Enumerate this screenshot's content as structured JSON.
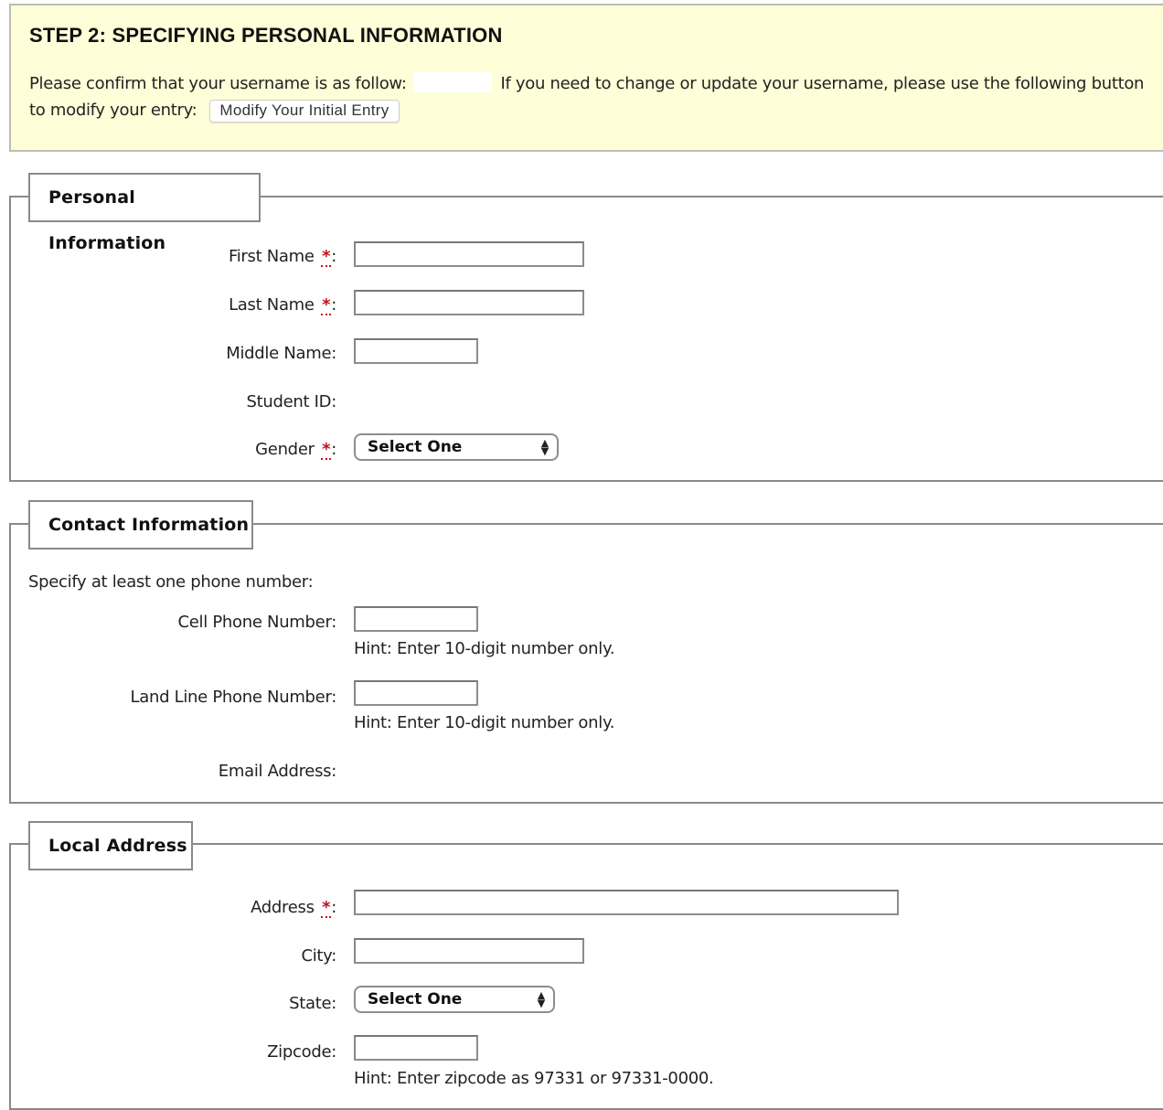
{
  "step": {
    "title": "STEP 2: SPECIFYING PERSONAL INFORMATION",
    "confirm_prefix": "Please confirm that your username is as follow:",
    "username_value": "",
    "confirm_suffix": "If you need to change or update your username, please use the following button",
    "modify_prefix": "to modify your entry:",
    "modify_button": "Modify Your Initial Entry"
  },
  "personal": {
    "legend": "Personal Information",
    "first_name": {
      "label": "First Name",
      "required": "*",
      "colon": ":",
      "value": ""
    },
    "last_name": {
      "label": "Last Name",
      "required": "*",
      "colon": ":",
      "value": ""
    },
    "middle_name": {
      "label": "Middle Name:",
      "value": ""
    },
    "student_id": {
      "label": "Student ID:",
      "value": ""
    },
    "gender": {
      "label": "Gender",
      "required": "*",
      "colon": ":",
      "selected": "Select One"
    }
  },
  "contact": {
    "legend": "Contact Information",
    "intro": "Specify at least one phone number:",
    "cell": {
      "label": "Cell Phone Number:",
      "value": "",
      "hint": "Hint: Enter 10-digit number only."
    },
    "landline": {
      "label": "Land Line Phone Number:",
      "value": "",
      "hint": "Hint: Enter 10-digit number only."
    },
    "email": {
      "label": "Email Address:",
      "value": ""
    }
  },
  "address": {
    "legend": "Local Address",
    "address": {
      "label": "Address",
      "required": "*",
      "colon": ":",
      "value": ""
    },
    "city": {
      "label": "City:",
      "value": ""
    },
    "state": {
      "label": "State:",
      "selected": "Select One"
    },
    "zipcode": {
      "label": "Zipcode:",
      "value": "",
      "hint": "Hint: Enter zipcode as 97331 or 97331-0000."
    }
  },
  "icons": {
    "select_arrows_up": "▲",
    "select_arrows_down": "▼"
  }
}
